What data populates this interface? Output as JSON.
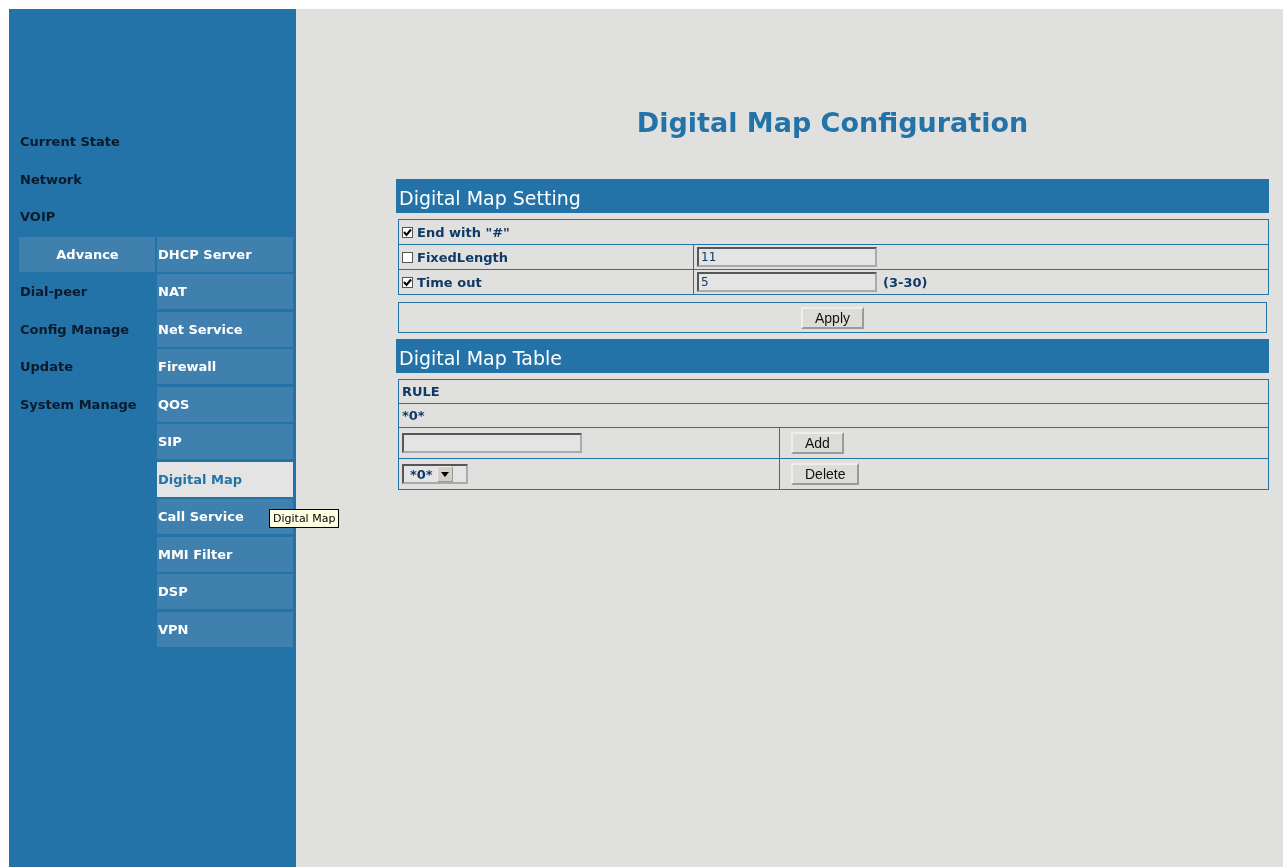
{
  "sidebar": {
    "items": [
      {
        "label": "Current State",
        "selected": false
      },
      {
        "label": "Network",
        "selected": false
      },
      {
        "label": "VOIP",
        "selected": false
      },
      {
        "label": "Advance",
        "selected": true
      },
      {
        "label": "Dial-peer",
        "selected": false
      },
      {
        "label": "Config Manage",
        "selected": false
      },
      {
        "label": "Update",
        "selected": false
      },
      {
        "label": "System Manage",
        "selected": false
      }
    ],
    "submenu": [
      {
        "label": "DHCP Server",
        "selected": false
      },
      {
        "label": "NAT",
        "selected": false
      },
      {
        "label": "Net Service",
        "selected": false
      },
      {
        "label": "Firewall",
        "selected": false
      },
      {
        "label": "QOS",
        "selected": false
      },
      {
        "label": "SIP",
        "selected": false
      },
      {
        "label": "Digital Map",
        "selected": true
      },
      {
        "label": "Call Service",
        "selected": false
      },
      {
        "label": "MMI Filter",
        "selected": false
      },
      {
        "label": "DSP",
        "selected": false
      },
      {
        "label": "VPN",
        "selected": false
      }
    ],
    "tooltip": "Digital Map"
  },
  "page_title": "Digital Map Configuration",
  "setting": {
    "title": "Digital Map Setting",
    "options": [
      {
        "label": "End with \"#\"",
        "checked": true
      },
      {
        "label": "FixedLength",
        "checked": false,
        "value": "11"
      },
      {
        "label": "Time out",
        "checked": true,
        "value": "5",
        "hint": "(3-30)"
      }
    ],
    "apply_button": "Apply"
  },
  "table": {
    "title": "Digital Map Table",
    "column_header": "RULE",
    "rows": [
      "*0*"
    ],
    "add_button": "Add",
    "select_value": "*0*",
    "delete_button": "Delete"
  }
}
